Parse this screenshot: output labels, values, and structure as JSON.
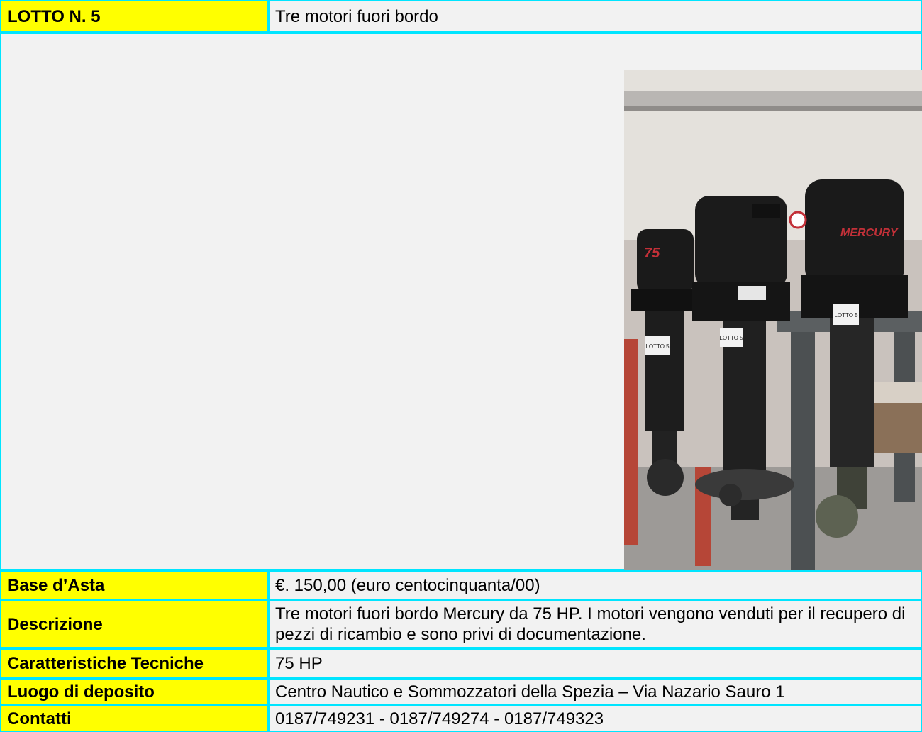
{
  "header": {
    "lot_label": "LOTTO N. 5",
    "lot_title": "Tre motori fuori bordo"
  },
  "photo": {
    "description_icon": "outboard-motors-photo",
    "engine_texts": [
      "75",
      "MERCURY",
      "MERCURY"
    ],
    "tags": [
      "LOTTO 5",
      "LOTTO 5",
      "LOTTO 5"
    ]
  },
  "rows": [
    {
      "label": "Base d’Asta",
      "value": "€. 150,00 (euro centocinquanta/00)"
    },
    {
      "label": "Descrizione",
      "value": "Tre motori fuori bordo Mercury da 75 HP. I motori vengono venduti per il recupero di pezzi di ricambio e sono privi di documentazione."
    },
    {
      "label": "Caratteristiche Tecniche",
      "value": "75 HP"
    },
    {
      "label": "Luogo di deposito",
      "value": "Centro Nautico e Sommozzatori della Spezia – Via Nazario Sauro 1"
    },
    {
      "label": "Contatti",
      "value": "0187/749231 - 0187/749274 - 0187/749323"
    }
  ]
}
